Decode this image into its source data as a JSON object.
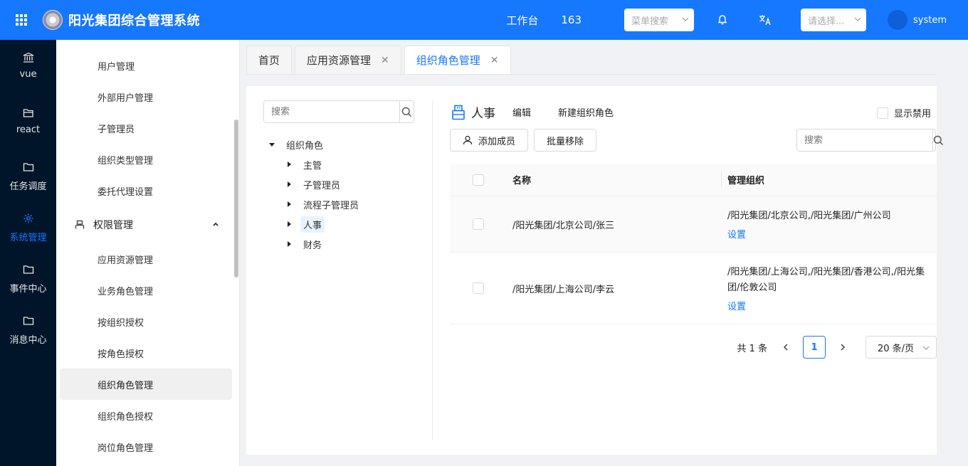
{
  "header": {
    "title": "阳光集团综合管理系统",
    "workbench": "工作台",
    "count": "163",
    "menu_search_placeholder": "菜单搜索",
    "select_placeholder": "请选择...",
    "user": "system",
    "brand_color": "#1677ff"
  },
  "nav": {
    "items": [
      {
        "label": "vue",
        "icon": "bank-icon"
      },
      {
        "label": "react",
        "icon": "folder-open-icon"
      },
      {
        "label": "任务调度",
        "icon": "folder-icon"
      },
      {
        "label": "系统管理",
        "icon": "gear-icon"
      },
      {
        "label": "事件中心",
        "icon": "folder-icon"
      },
      {
        "label": "消息中心",
        "icon": "folder-icon"
      }
    ]
  },
  "submenu": {
    "items_top": [
      "用户管理",
      "外部用户管理",
      "子管理员",
      "组织类型管理",
      "委托代理设置"
    ],
    "group": "权限管理",
    "items_group": [
      "应用资源管理",
      "业务角色管理",
      "按组织授权",
      "按角色授权",
      "组织角色管理",
      "组织角色授权",
      "岗位角色管理"
    ]
  },
  "tabs": [
    "首页",
    "应用资源管理",
    "组织角色管理"
  ],
  "tree": {
    "search_placeholder": "搜索",
    "root": "组织角色",
    "children": [
      "主管",
      "子管理员",
      "流程子管理员",
      "人事",
      "财务"
    ]
  },
  "role": {
    "name": "人事",
    "edit": "编辑",
    "new": "新建组织角色",
    "show_disabled": "显示禁用",
    "add_member": "添加成员",
    "batch_remove": "批量移除",
    "member_search_placeholder": "搜索"
  },
  "table": {
    "headers": [
      "名称",
      "管理组织"
    ],
    "rows": [
      {
        "name": "/阳光集团/北京公司/张三",
        "org": "/阳光集团/北京公司,/阳光集团/广州公司",
        "action": "设置"
      },
      {
        "name": "/阳光集团/上海公司/李云",
        "org": "/阳光集团/上海公司,/阳光集团/香港公司,/阳光集团/伦敦公司",
        "action": "设置"
      }
    ]
  },
  "pager": {
    "total": "共 1 条",
    "current": "1",
    "page_size": "20 条/页"
  }
}
